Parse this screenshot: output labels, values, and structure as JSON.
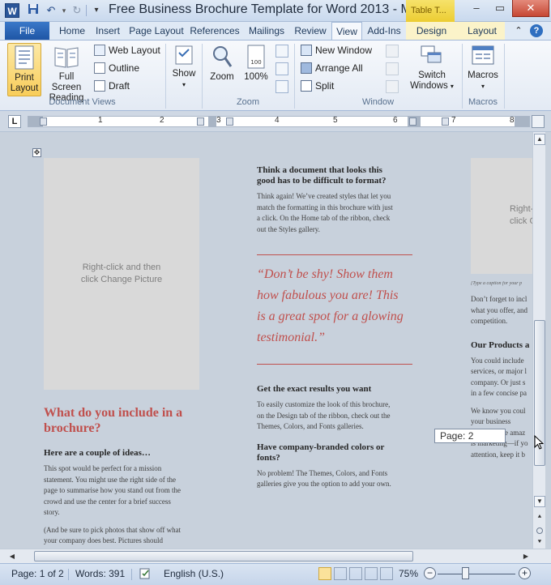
{
  "window": {
    "title": "Free Business Brochure Template for Word 2013 - M...",
    "context_tab_group": "Table T...",
    "app_logo_letter": "W"
  },
  "tabs": {
    "file": "File",
    "items": [
      "Home",
      "Insert",
      "Page Layout",
      "References",
      "Mailings",
      "Review",
      "View",
      "Add-Ins",
      "Design",
      "Layout"
    ],
    "active": "View"
  },
  "ribbon": {
    "document_views": {
      "label": "Document Views",
      "print_layout": [
        "Print",
        "Layout"
      ],
      "full_screen_reading": [
        "Full Screen",
        "Reading"
      ],
      "web_layout": "Web Layout",
      "outline": "Outline",
      "draft": "Draft"
    },
    "show": {
      "label": "Show"
    },
    "zoom": {
      "label": "Zoom",
      "zoom": "Zoom",
      "hundred": "100%"
    },
    "window": {
      "label": "Window",
      "new_window": "New Window",
      "arrange_all": "Arrange All",
      "split": "Split",
      "switch_windows": [
        "Switch",
        "Windows"
      ]
    },
    "macros": {
      "label": "Macros",
      "macros": "Macros"
    }
  },
  "ruler": {
    "numbers": [
      "1",
      "2",
      "3",
      "4",
      "5",
      "6",
      "7",
      "8"
    ]
  },
  "document": {
    "left": {
      "picture_text": [
        "Right-click and then",
        "click Change Picture"
      ],
      "heading": [
        "What do you include in a",
        "brochure?"
      ],
      "subheading": "Here are a couple of ideas…",
      "body": [
        "This spot would be perfect for a mission",
        "statement. You might use the right side of the",
        "page to summarise how you stand out from the",
        "crowd and use the center for a brief success",
        "story."
      ],
      "body2": [
        "(And be sure to pick photos that show off what",
        "your company does best. Pictures should"
      ]
    },
    "center": {
      "heading1": [
        "Think a document that looks this",
        "good has to be difficult to format?"
      ],
      "body1": [
        "Think again! We’ve created styles that let you",
        "match the formatting in this brochure with just",
        "a click. On the Home tab of the ribbon, check",
        "out the Styles gallery."
      ],
      "quote": [
        "“Don’t be shy! Show them",
        "how fabulous you are! This",
        "is a great spot for a glowing",
        "testimonial.”"
      ],
      "heading2": "Get the exact results you want",
      "body2": [
        "To easily customize the look of this brochure,",
        "on the Design tab of the ribbon, check out the",
        "Themes, Colors, and Fonts galleries."
      ],
      "heading3": [
        "Have company-branded colors or",
        "fonts?"
      ],
      "body3": [
        "No problem! The Themes, Colors, and Fonts",
        "galleries give you the option to add your own."
      ]
    },
    "right": {
      "picture_text": [
        "Right-",
        "click C"
      ],
      "caption": "[Type a caption for your p",
      "body1": [
        "Don’t forget to incl",
        "what you offer, and",
        "competition."
      ],
      "heading": "Our Products a",
      "body2": [
        "You could include",
        "services, or major l",
        "company. Or just s",
        "in a few concise pa"
      ],
      "body3": [
        "We know you coul",
        "your business",
        "you—you’re amaz",
        "is marketing—if yo",
        "attention, keep it b"
      ]
    },
    "page_tooltip": "Page: 2"
  },
  "status": {
    "page": "Page: 1 of 2",
    "words": "Words: 391",
    "language": "English (U.S.)",
    "zoom": "75%"
  }
}
